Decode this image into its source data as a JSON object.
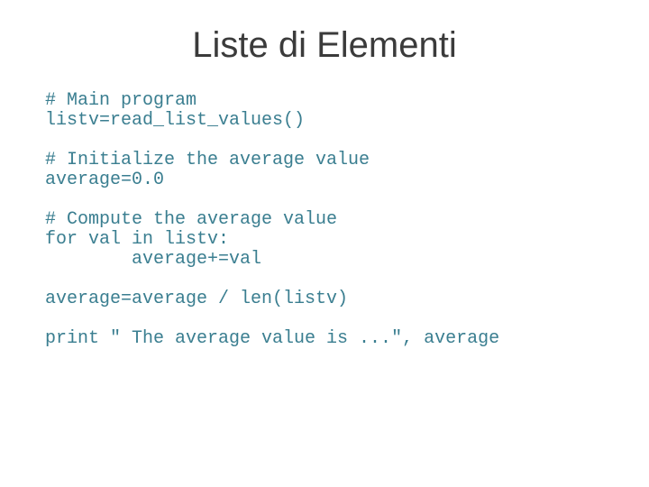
{
  "title": "Liste di Elementi",
  "code": {
    "g1l1": "# Main program",
    "g1l2": "listv=read_list_values()",
    "g2l1": "# Initialize the average value",
    "g2l2": "average=0.0",
    "g3l1": "# Compute the average value",
    "g3l2": "for val in listv:",
    "g3l3": "        average+=val",
    "g4l1": "average=average / len(listv)",
    "g5l1": "print \" The average value is ...\", average"
  }
}
